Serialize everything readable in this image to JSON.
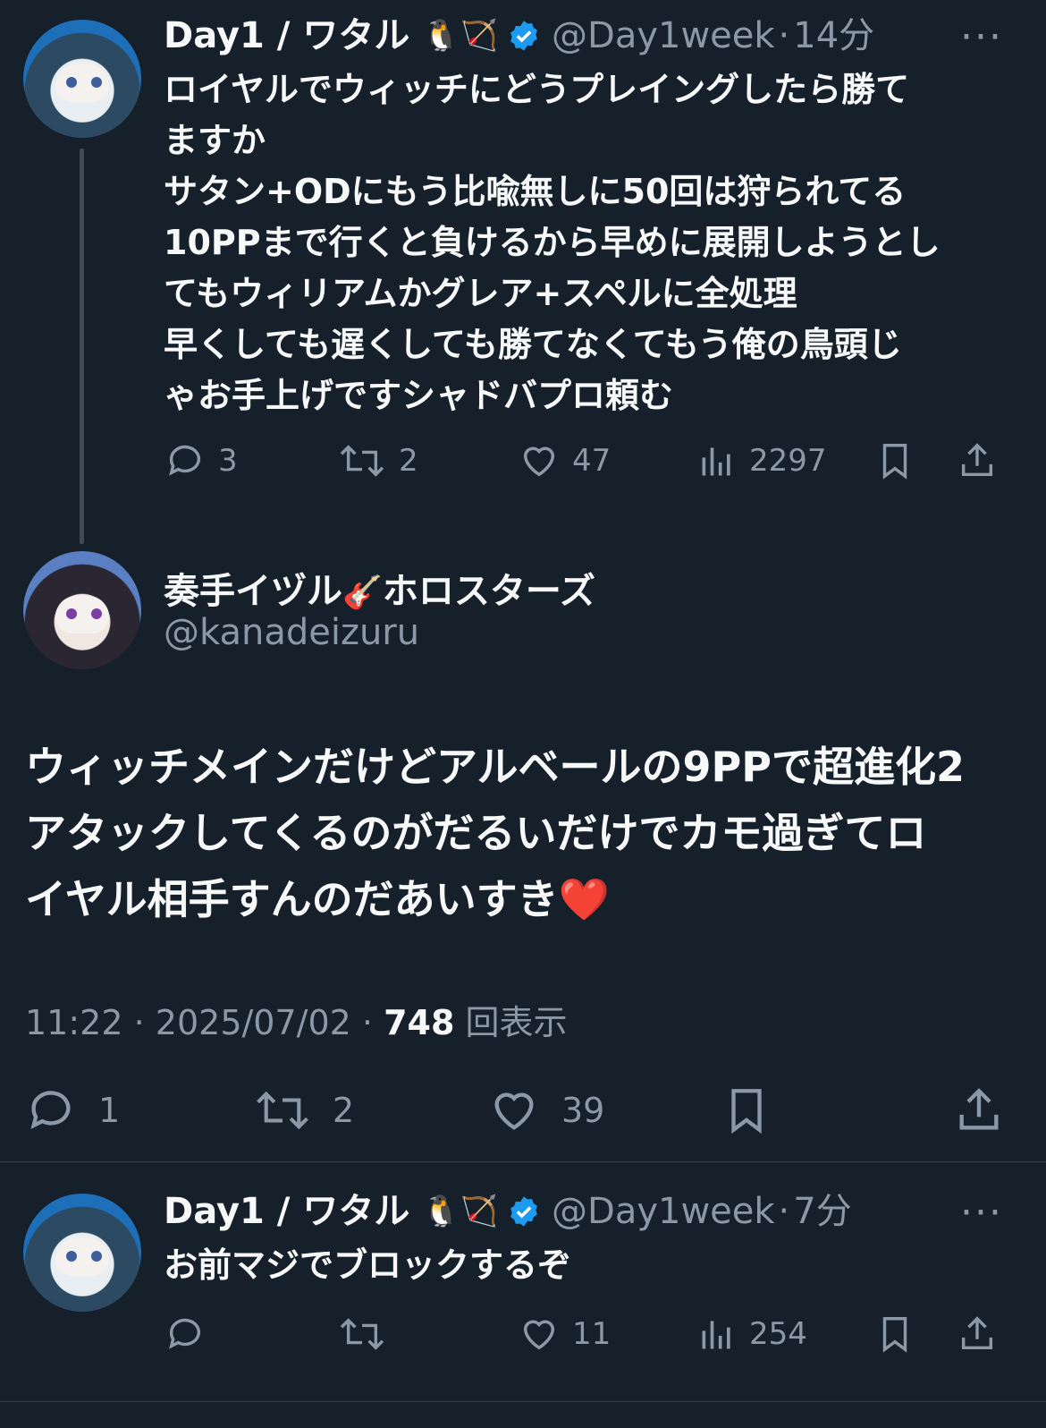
{
  "colors": {
    "background": "#15202b",
    "text": "#f7f9f9",
    "muted": "#8b98a5",
    "verified": "#1d9bf0",
    "heart": "#e0245e"
  },
  "tweet1": {
    "name": "Day1 / ワタル",
    "emoji": "🐧🏹",
    "handle": "@Day1week",
    "sep": "·",
    "time": "14分",
    "more": "···",
    "lines": [
      "ロイヤルでウィッチにどうプレイングしたら勝て",
      "ますか",
      "サタン+ODにもう比喩無しに50回は狩られてる",
      "10PPまで行くと負けるから早めに展開しようとし",
      "てもウィリアムかグレア+スペルに全処理",
      "早くしても遅くしても勝てなくてもう俺の鳥頭じ",
      "ゃお手上げですシャドバプロ頼む"
    ],
    "replies": "3",
    "retweets": "2",
    "likes": "47",
    "views": "2297"
  },
  "main": {
    "name": "奏手イヅル",
    "emoji": "🎸",
    "name_suffix": "ホロスターズ",
    "handle": "@kanadeizuru",
    "lines": [
      "ウィッチメインだけどアルベールの9PPで超進化2",
      "アタックしてくるのがだるいだけでカモ過ぎてロ",
      "イヤル相手すんのだあいすき❤️"
    ],
    "time": "11:22",
    "sep": "·",
    "date": "2025/07/02",
    "views_count": "748",
    "views_label": "回表示",
    "replies": "1",
    "retweets": "2",
    "likes": "39"
  },
  "tweet3": {
    "name": "Day1 / ワタル",
    "emoji": "🐧🏹",
    "handle": "@Day1week",
    "sep": "·",
    "time": "7分",
    "more": "···",
    "text": "お前マジでブロックするぞ",
    "replies": "",
    "retweets": "",
    "likes": "11",
    "views": "254"
  }
}
